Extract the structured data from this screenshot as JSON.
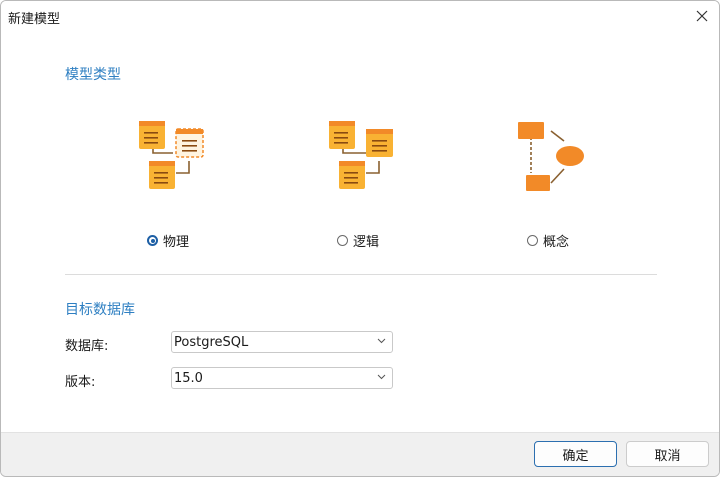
{
  "window": {
    "title": "新建模型"
  },
  "model_type": {
    "heading": "模型类型",
    "options": [
      {
        "label": "物理",
        "checked": true,
        "icon": "physical-model-icon"
      },
      {
        "label": "逻辑",
        "checked": false,
        "icon": "logical-model-icon"
      },
      {
        "label": "概念",
        "checked": false,
        "icon": "conceptual-model-icon"
      }
    ]
  },
  "target_db": {
    "heading": "目标数据库",
    "database_label": "数据库:",
    "database_value": "PostgreSQL",
    "version_label": "版本:",
    "version_value": "15.0"
  },
  "buttons": {
    "ok": "确定",
    "cancel": "取消"
  },
  "colors": {
    "accent": "#2e7fc2",
    "icon_orange": "#f28a28",
    "icon_yellow": "#f9b233",
    "connector": "#8a6030"
  }
}
